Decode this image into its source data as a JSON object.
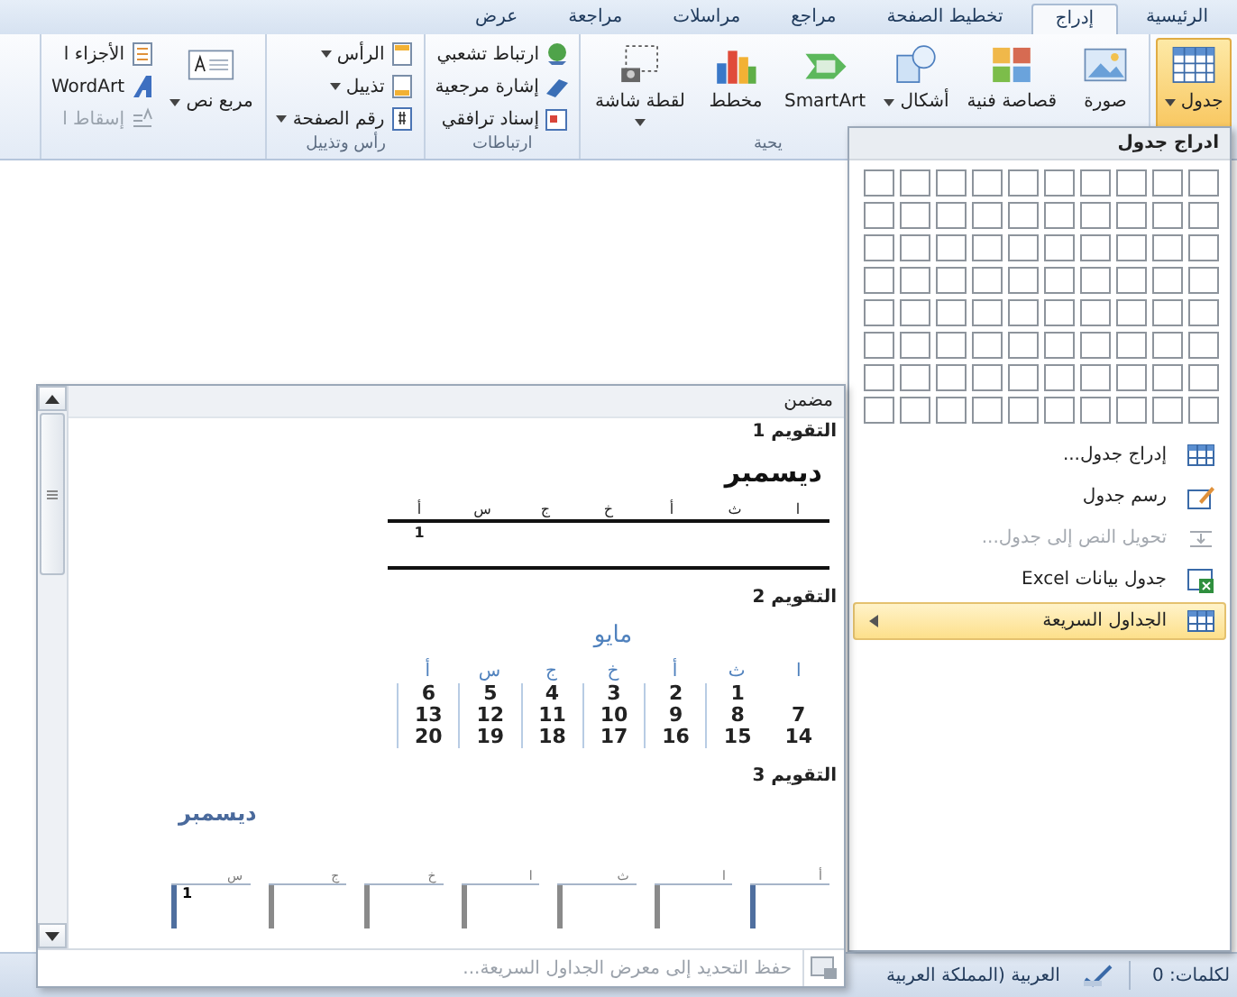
{
  "tabs": [
    {
      "label": "الرئيسية",
      "selected": false
    },
    {
      "label": "إدراج",
      "selected": true
    },
    {
      "label": "تخطيط الصفحة",
      "selected": false
    },
    {
      "label": "مراجع",
      "selected": false
    },
    {
      "label": "مراسلات",
      "selected": false
    },
    {
      "label": "مراجعة",
      "selected": false
    },
    {
      "label": "عرض",
      "selected": false
    }
  ],
  "ribbon": {
    "groups": [
      {
        "items": [
          {
            "label": "جدول",
            "kind": "large",
            "dropdown": true,
            "selected": true
          }
        ]
      },
      {
        "label": "يحية",
        "items": [
          {
            "label": "صورة",
            "kind": "large",
            "dropdown": false
          },
          {
            "label": "قصاصة فنية",
            "kind": "large",
            "dropdown": false
          },
          {
            "label": "أشكال",
            "kind": "large",
            "dropdown": true
          },
          {
            "label": "SmartArt",
            "kind": "large",
            "dropdown": false
          },
          {
            "label": "مخطط",
            "kind": "large",
            "dropdown": false
          },
          {
            "label": "لقطة شاشة",
            "kind": "large",
            "dropdown": true
          }
        ]
      },
      {
        "label": "ارتباطات",
        "items": [
          {
            "label": "ارتباط تشعبي",
            "kind": "small",
            "dropdown": false
          },
          {
            "label": "إشارة مرجعية",
            "kind": "small",
            "dropdown": false
          },
          {
            "label": "إسناد ترافقي",
            "kind": "small",
            "dropdown": false
          }
        ]
      },
      {
        "label": "رأس وتذييل",
        "items": [
          {
            "label": "الرأس",
            "kind": "small",
            "dropdown": true
          },
          {
            "label": "تذييل",
            "kind": "small",
            "dropdown": true
          },
          {
            "label": "رقم الصفحة",
            "kind": "small",
            "dropdown": true
          }
        ]
      },
      {
        "items": [
          {
            "label": "مربع نص",
            "kind": "large",
            "dropdown": true,
            "disabled": false
          },
          {
            "label": "الأجزاء ا",
            "kind": "small",
            "dropdown": false,
            "disabled": false
          },
          {
            "label": "WordArt",
            "kind": "small",
            "dropdown": false,
            "disabled": false
          },
          {
            "label": "إسقاط ا",
            "kind": "small",
            "dropdown": false,
            "disabled": true
          }
        ]
      }
    ]
  },
  "insert_table_menu": {
    "title": "ادراج جدول",
    "items": [
      {
        "label": "إدراج جدول...",
        "disabled": false,
        "selected": false,
        "submenu": false
      },
      {
        "label": "رسم جدول",
        "disabled": false,
        "selected": false,
        "submenu": false
      },
      {
        "label": "تحويل النص إلى جدول...",
        "disabled": true,
        "selected": false,
        "submenu": false
      },
      {
        "label": "جدول بيانات Excel",
        "disabled": false,
        "selected": false,
        "submenu": false
      },
      {
        "label": "الجداول السريعة",
        "disabled": false,
        "selected": true,
        "submenu": true
      }
    ]
  },
  "quick_tables_gallery": {
    "category": "مضمن",
    "entries": [
      {
        "title": "التقويم 1",
        "kind": "ruled",
        "month": "ديسمبر",
        "weekdays": [
          "ا",
          "ث",
          "أ",
          "خ",
          "ج",
          "س",
          "أ"
        ],
        "weeks": [
          {
            "kind": "trailing",
            "days": [
              "1"
            ]
          }
        ]
      },
      {
        "title": "التقويم 2",
        "kind": "blue",
        "month": "مايو",
        "weekdays": [
          "ا",
          "ث",
          "أ",
          "خ",
          "ج",
          "س",
          "أ"
        ],
        "weeks": [
          {
            "kind": "trailing",
            "days": [
              "1",
              "2",
              "3",
              "4",
              "5",
              "6"
            ]
          },
          {
            "kind": "trailing",
            "days": [
              "7",
              "8",
              "9",
              "10",
              "11",
              "12",
              "13"
            ]
          },
          {
            "kind": "trailing",
            "days": [
              "14",
              "15",
              "16",
              "17",
              "18",
              "19",
              "20"
            ]
          }
        ]
      },
      {
        "title": "التقويم 3",
        "kind": "bars",
        "month": "ديسمبر",
        "weekdays": [
          "أ",
          "ا",
          "ث",
          "ا",
          "خ",
          "ج",
          "س"
        ],
        "weeks": [
          {
            "kind": "trailing",
            "days": [
              "1"
            ]
          }
        ]
      }
    ],
    "footer": "حفظ التحديد إلى معرض الجداول السريعة..."
  },
  "status_bar": {
    "word_count": "لكلمات: 0",
    "language": "العربية (المملكة العربية"
  }
}
